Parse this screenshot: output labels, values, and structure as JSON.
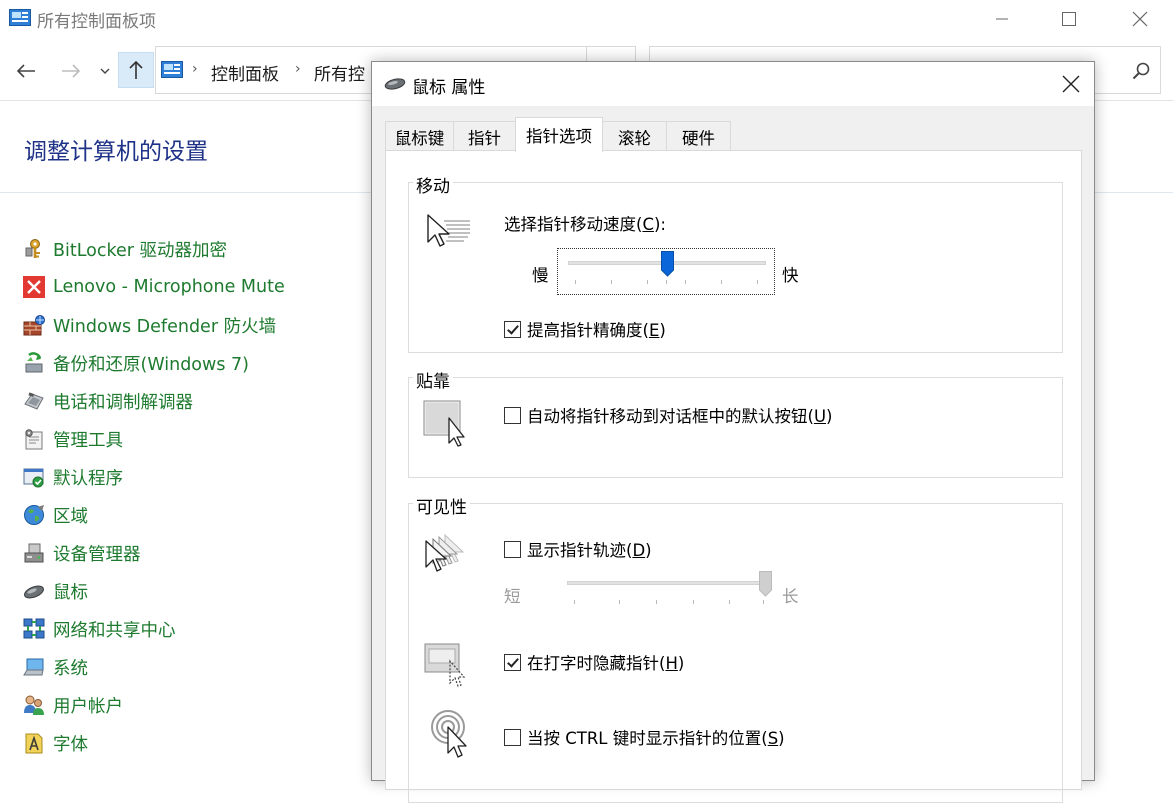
{
  "window": {
    "title": "所有控制面板项",
    "breadcrumb": [
      "控制面板",
      "所有控"
    ],
    "page_title": "调整计算机的设置"
  },
  "items": [
    {
      "label": "BitLocker 驱动器加密",
      "icon": "bitlocker-key-icon"
    },
    {
      "label": "Lenovo - Microphone Mute",
      "icon": "microphone-mute-icon"
    },
    {
      "label": "Windows Defender 防火墙",
      "icon": "firewall-icon"
    },
    {
      "label": "备份和还原(Windows 7)",
      "icon": "backup-restore-icon"
    },
    {
      "label": "电话和调制解调器",
      "icon": "phone-modem-icon"
    },
    {
      "label": "管理工具",
      "icon": "admin-tools-icon"
    },
    {
      "label": "默认程序",
      "icon": "default-programs-icon"
    },
    {
      "label": "区域",
      "icon": "region-globe-icon"
    },
    {
      "label": "设备管理器",
      "icon": "device-manager-icon"
    },
    {
      "label": "鼠标",
      "icon": "mouse-icon"
    },
    {
      "label": "网络和共享中心",
      "icon": "network-icon"
    },
    {
      "label": "系统",
      "icon": "system-icon"
    },
    {
      "label": "用户帐户",
      "icon": "user-accounts-icon"
    },
    {
      "label": "字体",
      "icon": "fonts-icon"
    }
  ],
  "dialog": {
    "title": "鼠标 属性",
    "tabs": [
      "鼠标键",
      "指针",
      "指针选项",
      "滚轮",
      "硬件"
    ],
    "active_tab": "指针选项",
    "motion": {
      "group_label": "移动",
      "speed_label_prefix": "选择指针移动速度(",
      "speed_key": "C",
      "speed_label_suffix": "):",
      "slow": "慢",
      "fast": "快",
      "speed_fraction": 0.5,
      "precision_prefix": "提高指针精确度(",
      "precision_key": "E",
      "precision_suffix": ")",
      "precision_checked": true
    },
    "snap": {
      "group_label": "贴靠",
      "label_prefix": "自动将指针移动到对话框中的默认按钮(",
      "key": "U",
      "label_suffix": ")",
      "checked": false
    },
    "visibility": {
      "group_label": "可见性",
      "trails_prefix": "显示指针轨迹(",
      "trails_key": "D",
      "trails_suffix": ")",
      "trails_checked": false,
      "short": "短",
      "long": "长",
      "trail_fraction": 1.0,
      "hide_prefix": "在打字时隐藏指针(",
      "hide_key": "H",
      "hide_suffix": ")",
      "hide_checked": true,
      "ctrl_prefix": "当按 CTRL 键时显示指针的位置(",
      "ctrl_key": "S",
      "ctrl_suffix": ")",
      "ctrl_checked": false
    }
  },
  "colors": {
    "link_green": "#1d7a2e",
    "title_blue": "#1e3287",
    "slider_blue": "#0a66d9"
  }
}
